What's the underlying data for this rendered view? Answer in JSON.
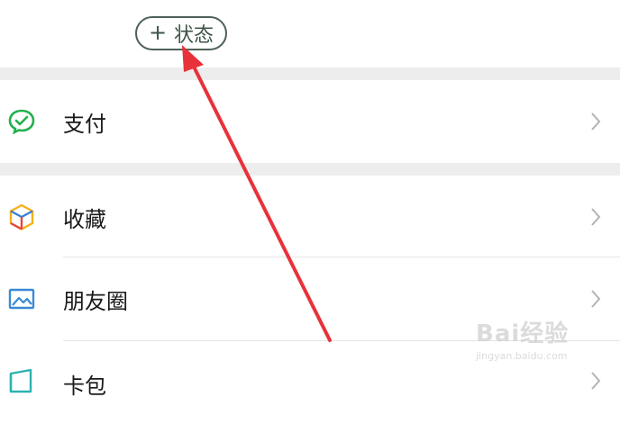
{
  "status_button": {
    "plus": "+",
    "label": "状态"
  },
  "menu": [
    {
      "label": "支付",
      "icon": "wechat-pay-icon"
    },
    {
      "label": "收藏",
      "icon": "favorites-cube-icon"
    },
    {
      "label": "朋友圈",
      "icon": "moments-image-icon"
    },
    {
      "label": "卡包",
      "icon": "card-wallet-icon"
    }
  ],
  "watermark": {
    "title": "Bai经验",
    "url": "jingyan.baidu.com"
  },
  "colors": {
    "accent_red": "#e8323a",
    "pay_green": "#22b14c",
    "text": "#1a1a1a",
    "separator": "#ededed"
  }
}
